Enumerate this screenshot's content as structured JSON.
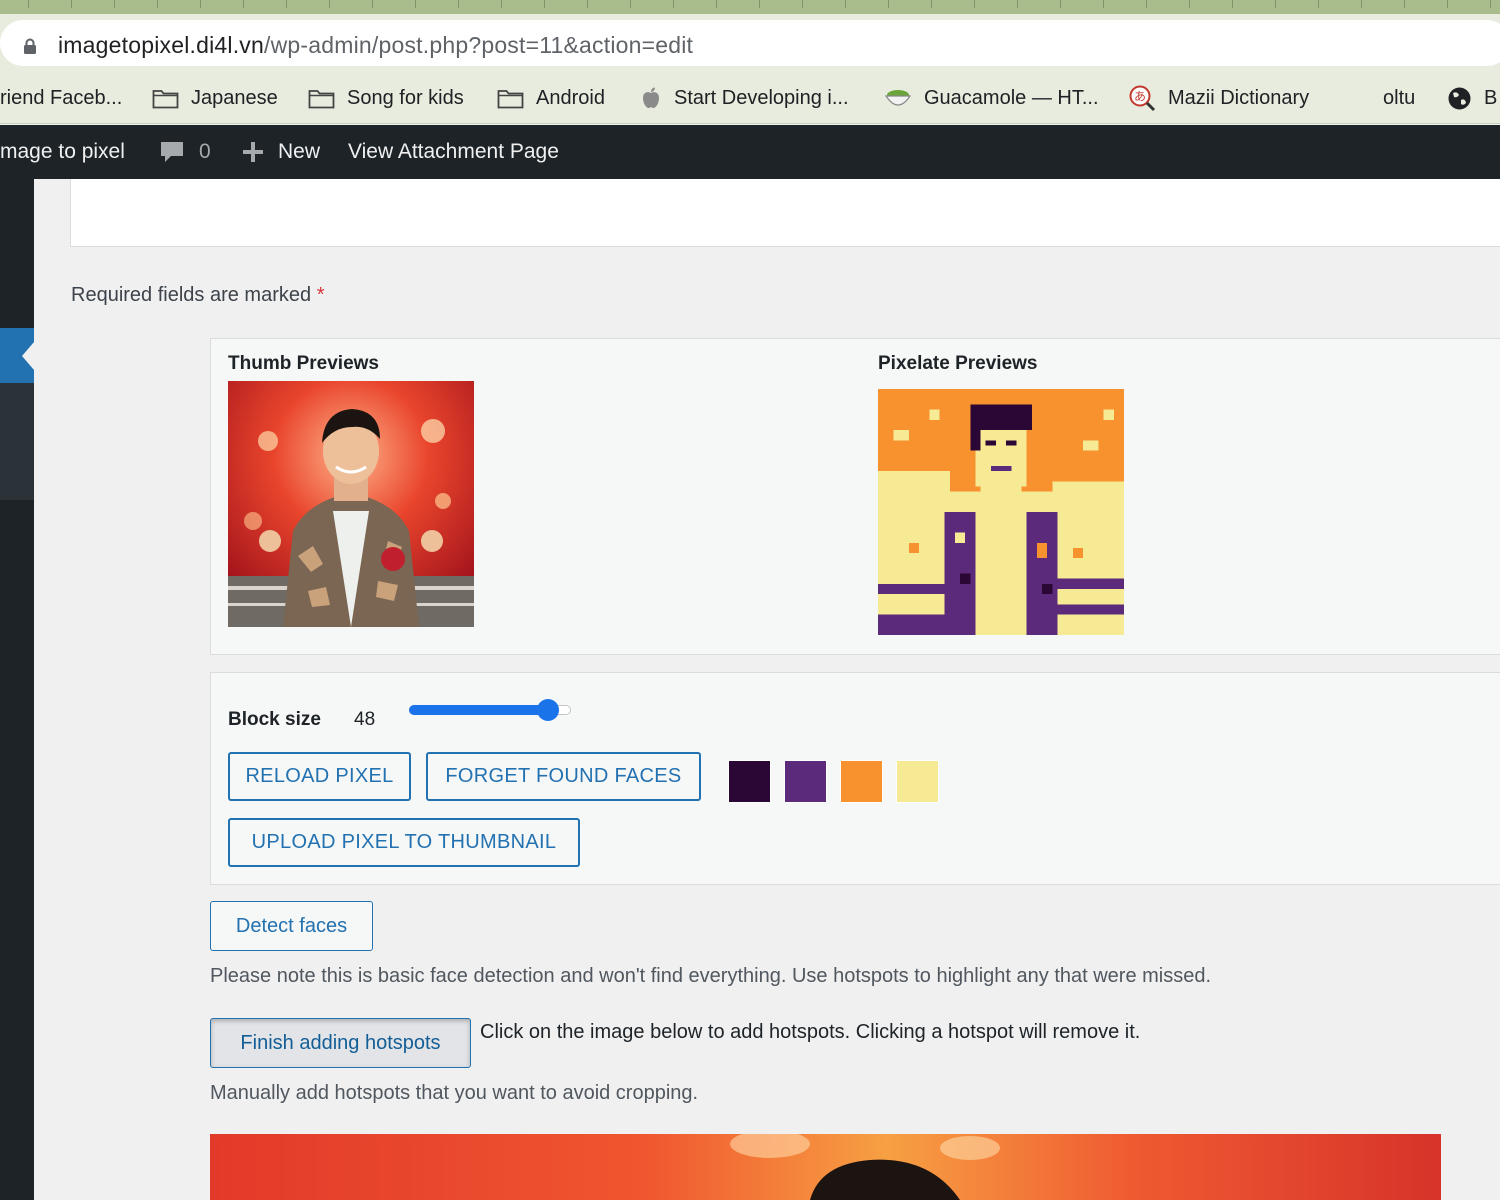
{
  "browser": {
    "url_host": "imagetopixel.di4l.vn",
    "url_path": "/wp-admin/post.php?post=11&action=edit",
    "bookmarks": [
      {
        "label": "riend Faceb...",
        "icon": "none"
      },
      {
        "label": "Japanese",
        "icon": "folder-icon"
      },
      {
        "label": "Song for kids",
        "icon": "folder-icon"
      },
      {
        "label": "Android",
        "icon": "folder-icon"
      },
      {
        "label": "Start Developing i...",
        "icon": "apple-icon"
      },
      {
        "label": "Guacamole — HT...",
        "icon": "guacamole-icon"
      },
      {
        "label": "Mazii Dictionary",
        "icon": "mazii-icon"
      },
      {
        "label": "oltu",
        "icon": "none"
      },
      {
        "label": "B",
        "icon": "globe-icon"
      }
    ]
  },
  "adminbar": {
    "site_name": "mage to pixel",
    "comments_count": "0",
    "new_label": "New",
    "view_label": "View Attachment Page"
  },
  "content": {
    "required_text": "Required fields are marked",
    "required_star": "*",
    "thumb_title": "Thumb Previews",
    "pixel_title": "Pixelate Previews",
    "block_size_label": "Block size",
    "block_size_value": "48",
    "block_slider_fraction": 0.86,
    "reload_label": "RELOAD PIXEL",
    "forget_label": "FORGET FOUND FACES",
    "upload_label": "UPLOAD PIXEL TO THUMBNAIL",
    "palette": [
      "#2a0735",
      "#5b2a7b",
      "#f7922f",
      "#f6ea94"
    ],
    "detect_label": "Detect faces",
    "detect_note": "Please note this is basic face detection and won't find everything. Use hotspots to highlight any that were missed.",
    "finish_label": "Finish adding hotspots",
    "finish_note": "Click on the image below to add hotspots. Clicking a hotspot will remove it.",
    "manual_note": "Manually add hotspots that you want to avoid cropping."
  },
  "colors": {
    "admin_bar": "#1d2327",
    "accent": "#2271b1",
    "slider": "#1a73e8",
    "required_star": "#d63638"
  }
}
